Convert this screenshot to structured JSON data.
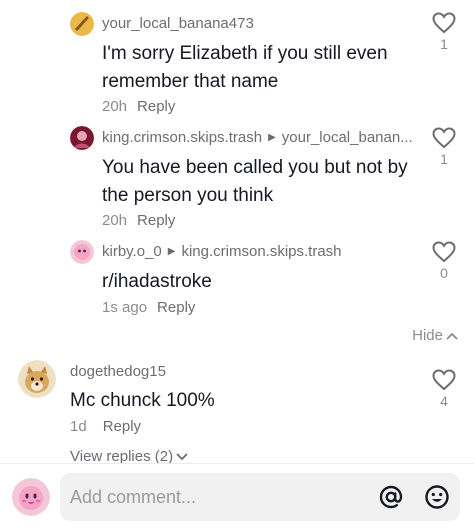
{
  "comments": [
    {
      "username": "your_local_banana473",
      "reply_to": "",
      "text_lines": [
        "I'm sorry Elizabeth if you still even",
        "remember that name"
      ],
      "time": "20h",
      "reply_label": "Reply",
      "likes": "1"
    },
    {
      "username": "king.crimson.skips.trash",
      "reply_to": "your_local_banan...",
      "text_lines": [
        "You have been called you but not by",
        "the person you think"
      ],
      "time": "20h",
      "reply_label": "Reply",
      "likes": "1"
    },
    {
      "username": "kirby.o_0",
      "reply_to": "king.crimson.skips.trash",
      "text_lines": [
        "r/ihadastroke"
      ],
      "time": "1s ago",
      "reply_label": "Reply",
      "likes": "0"
    },
    {
      "username": "dogethedog15",
      "reply_to": "",
      "text_lines": [
        "Mc chunck 100%"
      ],
      "time": "1d",
      "reply_label": "Reply",
      "likes": "4"
    }
  ],
  "hide_label": "Hide",
  "view_replies_label": "View replies (2)",
  "composer": {
    "placeholder": "Add comment...",
    "mention_icon": "at-icon",
    "emoji_icon": "emoji-icon"
  },
  "icons": {
    "like": "heart-outline-icon",
    "reply_arrow": "triangle-right-icon",
    "chevron_up": "chevron-up-icon",
    "chevron_down": "chevron-down-icon"
  },
  "colors": {
    "text_primary": "#161823",
    "text_secondary": "#8a8b91",
    "input_bg": "#f1f1f2"
  }
}
